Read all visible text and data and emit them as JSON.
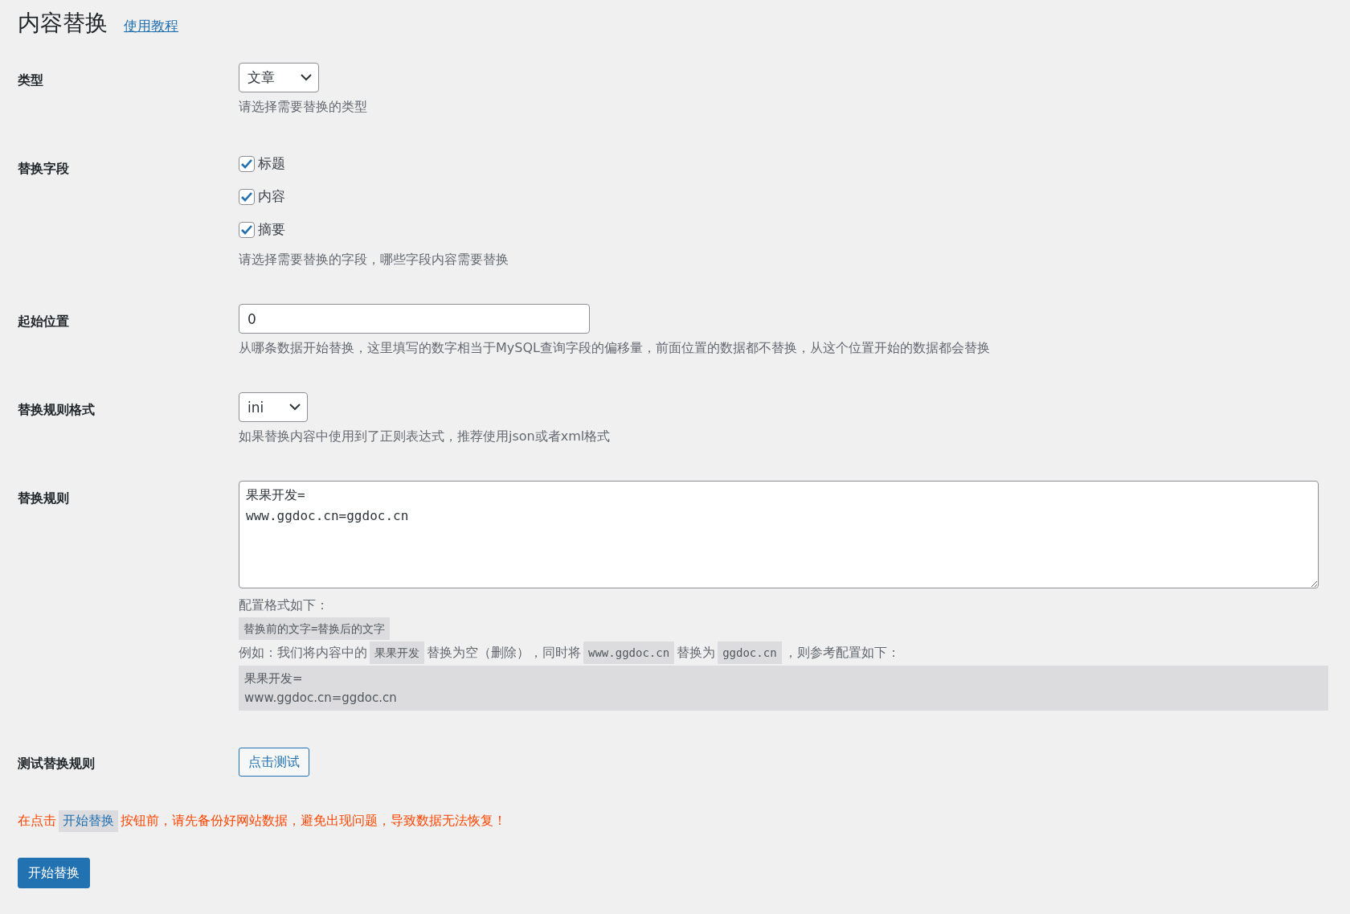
{
  "title": "内容替换",
  "tutorial_link": "使用教程",
  "rows": [
    {
      "kind": "select",
      "label": "类型",
      "value": "文章",
      "description": "请选择需要替换的类型"
    },
    {
      "kind": "checkboxes",
      "label": "替换字段",
      "options": [
        {
          "label": "标题",
          "checked": true
        },
        {
          "label": "内容",
          "checked": true
        },
        {
          "label": "摘要",
          "checked": true
        }
      ],
      "description": "请选择需要替换的字段，哪些字段内容需要替换"
    },
    {
      "kind": "text",
      "label": "起始位置",
      "value": "0",
      "description": "从哪条数据开始替换，这里填写的数字相当于MySQL查询字段的偏移量，前面位置的数据都不替换，从这个位置开始的数据都会替换"
    },
    {
      "kind": "select",
      "label": "替换规则格式",
      "value": "ini",
      "description": "如果替换内容中使用到了正则表达式，推荐使用json或者xml格式"
    },
    {
      "kind": "textarea",
      "label": "替换规则",
      "value": "果果开发=\nwww.ggdoc.cn=ggdoc.cn",
      "help": [
        {
          "kind": "text",
          "text": "配置格式如下："
        },
        {
          "kind": "code",
          "text": "替换前的文字=替换后的文字"
        },
        {
          "kind": "parts",
          "parts": [
            {
              "kind": "text",
              "text": "例如：我们将内容中的"
            },
            {
              "kind": "code",
              "text": "果果开发"
            },
            {
              "kind": "text",
              "text": "替换为空（删除），同时将"
            },
            {
              "kind": "code",
              "text": "www.ggdoc.cn"
            },
            {
              "kind": "text",
              "text": "替换为"
            },
            {
              "kind": "code",
              "text": "ggdoc.cn"
            },
            {
              "kind": "text",
              "text": "，则参考配置如下："
            }
          ]
        },
        {
          "kind": "pre",
          "lines": [
            "果果开发=",
            "www.ggdoc.cn=ggdoc.cn"
          ]
        }
      ]
    },
    {
      "kind": "button",
      "label": "测试替换规则",
      "button": "点击测试"
    }
  ],
  "warning": [
    {
      "kind": "text",
      "text": "在点击"
    },
    {
      "kind": "code",
      "text": "开始替换"
    },
    {
      "kind": "text",
      "text": "按钮前，请先备份好网站数据，避免出现问题，导致数据无法恢复！"
    }
  ],
  "submit": "开始替换"
}
